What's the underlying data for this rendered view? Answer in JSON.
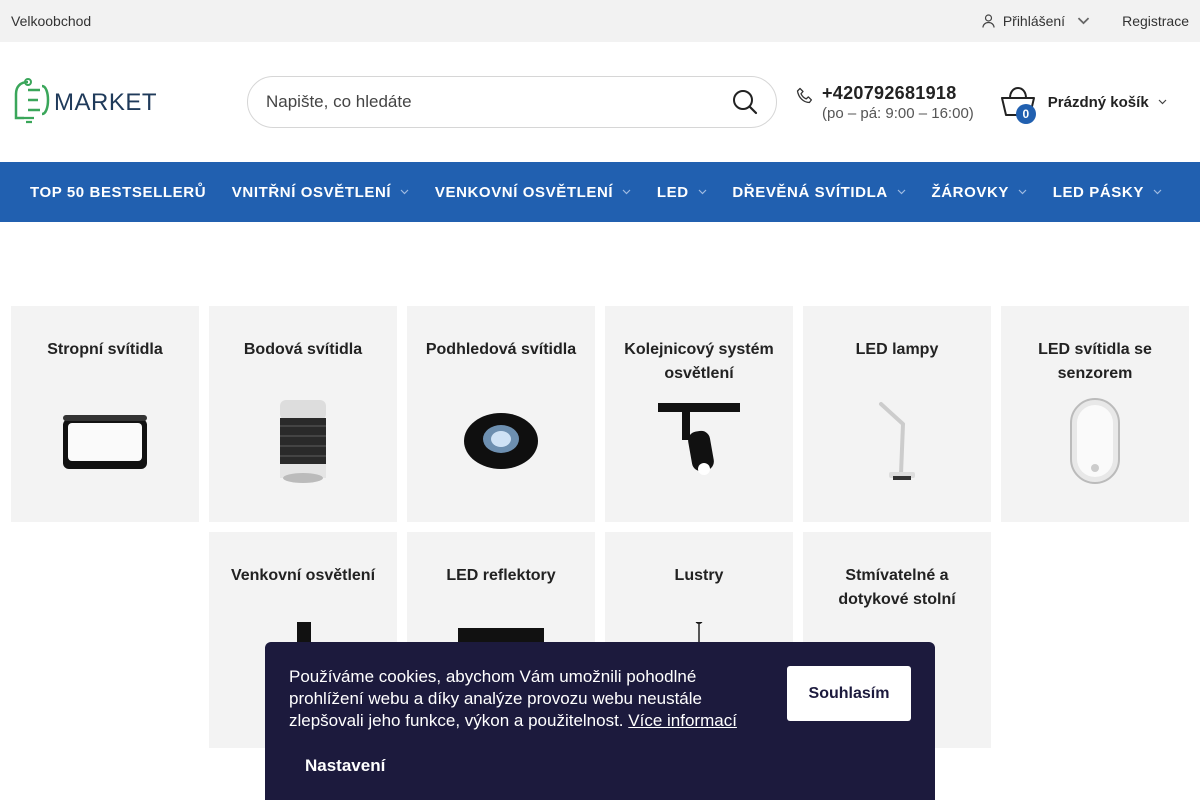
{
  "topbar": {
    "wholesale": "Velkoobchod",
    "login": "Přihlášení",
    "register": "Registrace"
  },
  "header": {
    "logo_text": "LEDMARKET",
    "search_placeholder": "Napište, co hledáte",
    "phone_number": "+420792681918",
    "phone_hours": "(po – pá: 9:00 – 16:00)",
    "cart_count": "0",
    "cart_label": "Prázdný košík"
  },
  "nav": {
    "items": [
      {
        "label": "TOP 50 BESTSELLERŮ"
      },
      {
        "label": "VNITŘNÍ OSVĚTLENÍ"
      },
      {
        "label": "VENKOVNÍ OSVĚTLENÍ"
      },
      {
        "label": "LED"
      },
      {
        "label": "DŘEVĚNÁ SVÍTIDLA"
      },
      {
        "label": "ŽÁROVKY"
      },
      {
        "label": "LED PÁSKY"
      }
    ]
  },
  "categories": [
    {
      "title": "Stropní svítidla",
      "icon": "ceiling-light-icon"
    },
    {
      "title": "Bodová svítidla",
      "icon": "spot-light-icon"
    },
    {
      "title": "Podhledová svítidla",
      "icon": "downlight-icon"
    },
    {
      "title": "Kolejnicový systém osvětlení",
      "icon": "track-light-icon"
    },
    {
      "title": "LED lampy",
      "icon": "desk-lamp-icon"
    },
    {
      "title": "LED svítidla se senzorem",
      "icon": "sensor-light-icon"
    },
    {
      "title": "Venkovní osvětlení",
      "icon": "outdoor-light-icon"
    },
    {
      "title": "LED reflektory",
      "icon": "floodlight-icon"
    },
    {
      "title": "Lustry",
      "icon": "chandelier-icon"
    },
    {
      "title": "Stmívatelné a dotykové stolní",
      "icon": "table-lamp-icon"
    }
  ],
  "cookie": {
    "text": "Používáme cookies, abychom Vám umožnili pohodlné prohlížení webu a díky analýze provozu webu neustále zlepšovali jeho funkce, výkon a použitelnost.",
    "more_info": "Více informací",
    "accept": "Souhlasím",
    "settings": "Nastavení"
  },
  "colors": {
    "brand_blue": "#2160b0",
    "logo_green": "#3aa65a",
    "cookie_bg": "#1c1a3d"
  }
}
